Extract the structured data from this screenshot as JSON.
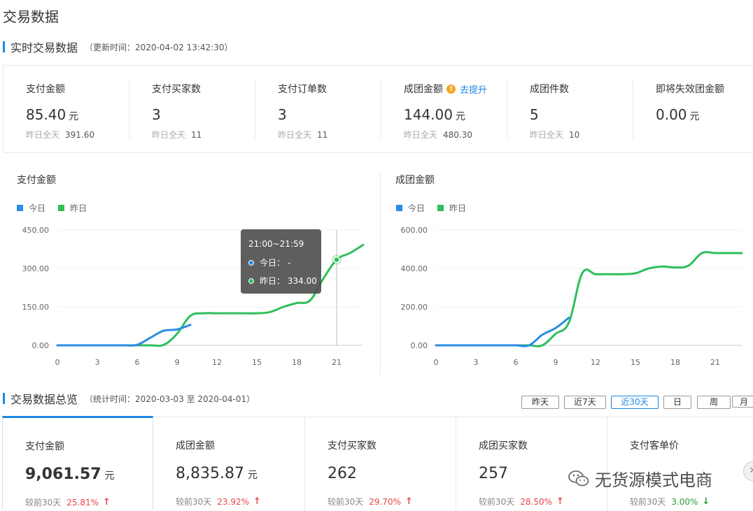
{
  "page_title": "交易数据",
  "realtime": {
    "title": "实时交易数据",
    "update_time": "（更新时间：2020-04-02 13:42:30）",
    "kpis": [
      {
        "label": "支付金额",
        "value": "85.40",
        "unit": "元",
        "prev_label": "昨日全天",
        "prev_value": "391.60"
      },
      {
        "label": "支付买家数",
        "value": "3",
        "unit": "",
        "prev_label": "昨日全天",
        "prev_value": "11"
      },
      {
        "label": "支付订单数",
        "value": "3",
        "unit": "",
        "prev_label": "昨日全天",
        "prev_value": "11"
      },
      {
        "label": "成团金额",
        "value": "144.00",
        "unit": "元",
        "prev_label": "昨日全天",
        "prev_value": "480.30",
        "link": "去提升"
      },
      {
        "label": "成团件数",
        "value": "5",
        "unit": "",
        "prev_label": "昨日全天",
        "prev_value": "10"
      },
      {
        "label": "即将失效团金额",
        "value": "0.00",
        "unit": "元",
        "prev_label": "",
        "prev_value": ""
      }
    ]
  },
  "legend": {
    "today": "今日",
    "yesterday": "昨日"
  },
  "colors": {
    "today": "#2b8ce6",
    "yesterday": "#2fbf5a",
    "accent": "#1e88e5",
    "up": "#e8474b",
    "down": "#2a9a3a"
  },
  "tooltip": {
    "title": "21:00~21:59",
    "today_label": "今日：",
    "today_value": "-",
    "yesterday_label": "昨日：",
    "yesterday_value": "334.00"
  },
  "chart_data": [
    {
      "type": "line",
      "title": "支付金额",
      "x": [
        0,
        1,
        2,
        3,
        4,
        5,
        6,
        7,
        8,
        9,
        10,
        11,
        12,
        13,
        14,
        15,
        16,
        17,
        18,
        19,
        20,
        21,
        22,
        23
      ],
      "xticks": [
        0,
        3,
        6,
        9,
        12,
        15,
        18,
        21
      ],
      "yticks": [
        "0.00",
        "150.00",
        "300.00",
        "450.00"
      ],
      "ylim": [
        0,
        450
      ],
      "series": [
        {
          "name": "今日",
          "values": [
            0,
            0,
            0,
            0,
            0,
            0,
            2,
            30,
            57,
            62,
            80,
            null,
            null,
            null,
            null,
            null,
            null,
            null,
            null,
            null,
            null,
            null,
            null,
            null
          ]
        },
        {
          "name": "昨日",
          "values": [
            0,
            0,
            0,
            0,
            0,
            0,
            0,
            0,
            2,
            45,
            115,
            125,
            125,
            125,
            125,
            125,
            130,
            150,
            165,
            175,
            260,
            334,
            360,
            392
          ]
        }
      ]
    },
    {
      "type": "line",
      "title": "成团金额",
      "x": [
        0,
        1,
        2,
        3,
        4,
        5,
        6,
        7,
        8,
        9,
        10,
        11,
        12,
        13,
        14,
        15,
        16,
        17,
        18,
        19,
        20,
        21,
        22,
        23
      ],
      "xticks": [
        0,
        3,
        6,
        9,
        12,
        15,
        18,
        21
      ],
      "yticks": [
        "0.00",
        "200.00",
        "400.00",
        "600.00"
      ],
      "ylim": [
        0,
        600
      ],
      "series": [
        {
          "name": "今日",
          "values": [
            0,
            0,
            0,
            0,
            0,
            0,
            0,
            0,
            55,
            90,
            144,
            null,
            null,
            null,
            null,
            null,
            null,
            null,
            null,
            null,
            null,
            null,
            null,
            null
          ]
        },
        {
          "name": "昨日",
          "values": [
            0,
            0,
            0,
            0,
            0,
            0,
            0,
            0,
            0,
            60,
            120,
            375,
            370,
            370,
            370,
            375,
            400,
            410,
            405,
            415,
            480,
            480,
            480,
            480
          ]
        }
      ]
    }
  ],
  "overview": {
    "title": "交易数据总览",
    "stat_time": "（统计时间：2020-03-03 至 2020-04-01）",
    "periods": [
      "昨天",
      "近7天",
      "近30天",
      "日",
      "周",
      "月"
    ],
    "active_period": "近30天",
    "cards": [
      {
        "label": "支付金额",
        "value": "9,061.57",
        "unit": "元",
        "cmp_label": "较前30天",
        "pct": "25.81%",
        "dir": "up"
      },
      {
        "label": "成团金额",
        "value": "8,835.87",
        "unit": "元",
        "cmp_label": "较前30天",
        "pct": "23.92%",
        "dir": "up"
      },
      {
        "label": "支付买家数",
        "value": "262",
        "unit": "",
        "cmp_label": "较前30天",
        "pct": "29.70%",
        "dir": "up"
      },
      {
        "label": "成团买家数",
        "value": "257",
        "unit": "",
        "cmp_label": "较前30天",
        "pct": "28.50%",
        "dir": "up"
      },
      {
        "label": "支付客单价",
        "value": "",
        "unit": "",
        "cmp_label": "较前30天",
        "pct": "3.00%",
        "dir": "down"
      }
    ]
  },
  "watermark": {
    "text": "无货源模式电商",
    "icon": "wechat-icon"
  },
  "close_icon": "close-icon"
}
